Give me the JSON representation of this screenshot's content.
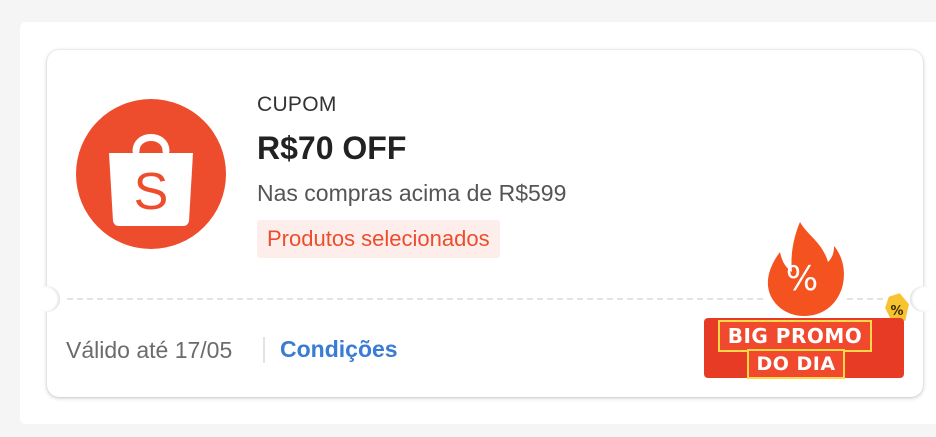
{
  "coupon": {
    "type_label": "CUPOM",
    "discount": "R$70 OFF",
    "min_purchase": "Nas compras acima de R$599",
    "scope_tag": "Produtos selecionados",
    "validity": "Válido até 17/05",
    "conditions_link": "Condições",
    "logo_letter": "S"
  },
  "promo_badge": {
    "line1": "BIG PROMO",
    "line2": "DO DIA",
    "icon_symbol": "%",
    "tag_symbol": "%"
  },
  "colors": {
    "brand": "#ee4d2d",
    "link": "#3a7bd5",
    "tag_bg": "#fdeeec",
    "badge_outline": "#ffd84a"
  }
}
